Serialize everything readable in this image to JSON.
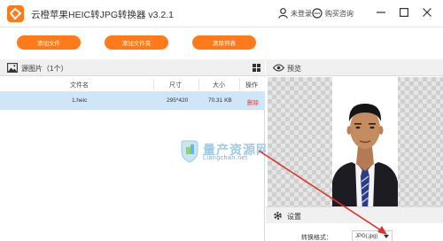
{
  "window": {
    "title": "云橙苹果HEIC转JPG转换器 v3.2.1",
    "login_label": "未登录",
    "purchase_label": "购买咨询"
  },
  "toolbar": {
    "add_file": "添加文件",
    "add_folder": "添加文件夹",
    "clear_list": "清除列表"
  },
  "source_panel": {
    "title": "源图片（1个）",
    "columns": [
      "文件名",
      "尺寸",
      "大小",
      "操作"
    ],
    "rows": [
      {
        "name": "1.heic",
        "size": "295*420",
        "filesize": "70.31 KB",
        "action": "删除"
      }
    ]
  },
  "watermark": {
    "title": "量产资源网",
    "subtitle": "Liangchan.net"
  },
  "preview_panel": {
    "title": "预览"
  },
  "settings_panel": {
    "title": "设置",
    "format_label": "转换格式：",
    "format_value": "JPG(.jpg)"
  },
  "colors": {
    "accent": "#ff7a1a",
    "selected_row": "#cfe6f8",
    "delete": "#e23b2e",
    "annotation_arrow": "#d9342b"
  },
  "icons": [
    "app-logo-icon",
    "user-icon",
    "chat-icon",
    "minimize-icon",
    "maximize-icon",
    "close-icon",
    "image-icon",
    "grid-view-icon",
    "eye-icon",
    "gear-icon",
    "dropdown-arrow-icon"
  ]
}
